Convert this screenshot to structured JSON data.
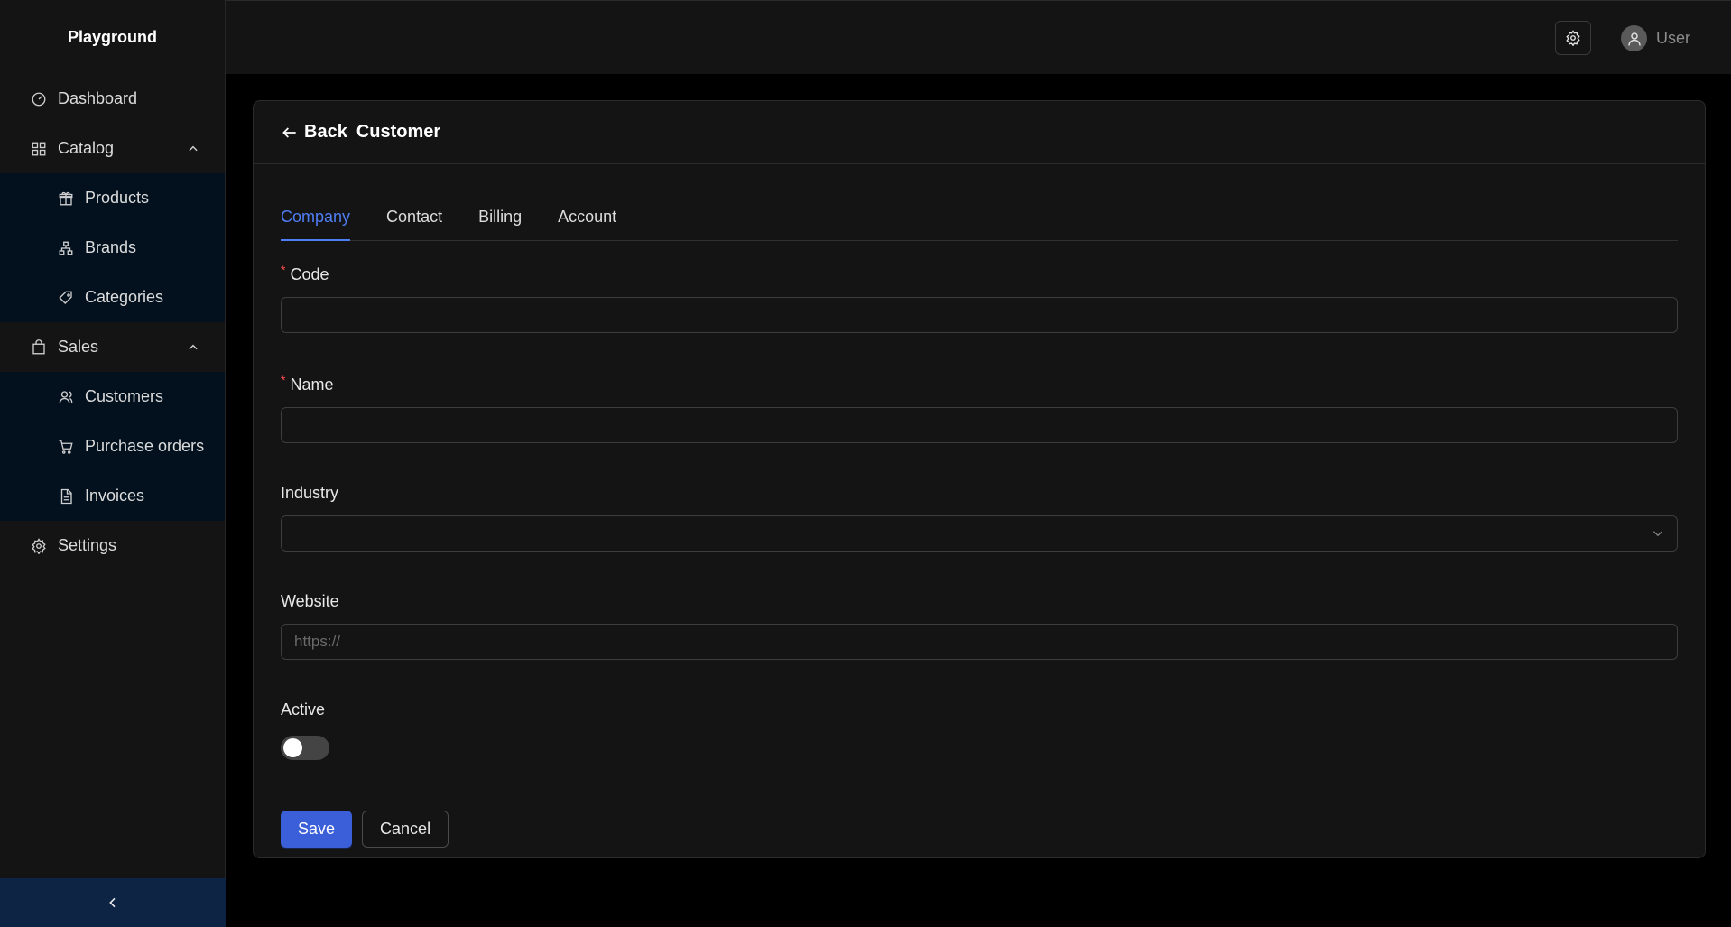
{
  "brand": "Playground",
  "sidebar": {
    "items": [
      {
        "label": "Dashboard",
        "icon": "dashboard-icon"
      },
      {
        "label": "Catalog",
        "icon": "grid-icon",
        "expanded": true,
        "children": [
          {
            "label": "Products",
            "icon": "gift-icon"
          },
          {
            "label": "Brands",
            "icon": "hierarchy-icon"
          },
          {
            "label": "Categories",
            "icon": "tag-icon"
          }
        ]
      },
      {
        "label": "Sales",
        "icon": "shopping-bag-icon",
        "expanded": true,
        "children": [
          {
            "label": "Customers",
            "icon": "users-icon"
          },
          {
            "label": "Purchase orders",
            "icon": "cart-icon"
          },
          {
            "label": "Invoices",
            "icon": "file-icon"
          }
        ]
      },
      {
        "label": "Settings",
        "icon": "gear-icon"
      }
    ],
    "collapse_icon": "chevron-left-icon"
  },
  "header": {
    "settings_icon": "gear-icon",
    "user_label": "User"
  },
  "card": {
    "back_label": "Back",
    "title": "Customer",
    "tabs": [
      {
        "label": "Company",
        "active": true
      },
      {
        "label": "Contact",
        "active": false
      },
      {
        "label": "Billing",
        "active": false
      },
      {
        "label": "Account",
        "active": false
      }
    ],
    "fields": {
      "code": {
        "label": "Code",
        "required": true,
        "value": ""
      },
      "name": {
        "label": "Name",
        "required": true,
        "value": ""
      },
      "industry": {
        "label": "Industry",
        "value": ""
      },
      "website": {
        "label": "Website",
        "value": "",
        "placeholder": "https://"
      },
      "active": {
        "label": "Active",
        "on": false
      }
    },
    "save_label": "Save",
    "cancel_label": "Cancel"
  },
  "colors": {
    "accent": "#4f7df3",
    "primary_button": "#3b5fd9",
    "required_mark": "#ff4d4f",
    "sidebar_submenu_bg": "#03111f",
    "collapse_bar_bg": "#0d2444"
  }
}
